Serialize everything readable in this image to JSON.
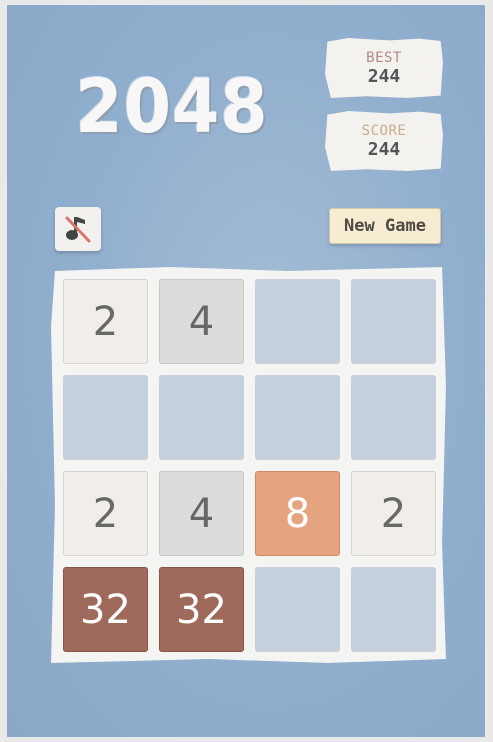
{
  "game": {
    "title": "2048"
  },
  "scores": {
    "best_label": "BEST",
    "best_value": "244",
    "score_label": "SCORE",
    "score_value": "244"
  },
  "controls": {
    "new_game_label": "New Game",
    "sound_icon": "sound-muted-icon"
  },
  "board": {
    "size": 4,
    "tiles": [
      [
        "2",
        "4",
        "",
        ""
      ],
      [
        "",
        "",
        "",
        ""
      ],
      [
        "2",
        "4",
        "8",
        "2"
      ],
      [
        "32",
        "32",
        "",
        ""
      ]
    ]
  },
  "colors": {
    "background": "#90aecd",
    "empty_cell": "#c6d0dc",
    "tile_2": "#f1eeea",
    "tile_4": "#dcdcdb",
    "tile_8": "#e5a47f",
    "tile_32": "#9f6a5c"
  }
}
